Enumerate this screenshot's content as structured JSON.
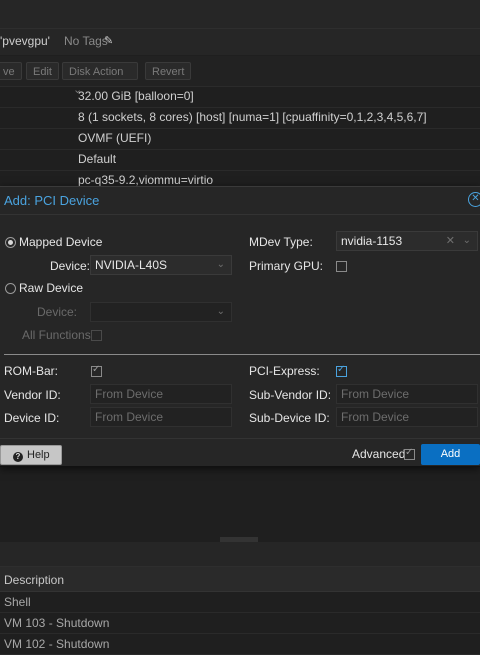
{
  "vm": {
    "name_fragment": "'pvevgpu'",
    "tags_label": "No Tags",
    "edit_tags_icon": "pencil-icon"
  },
  "toolbar": {
    "buttons": [
      "ve",
      "Edit",
      "Disk Action",
      "Revert"
    ],
    "disk_action_arrow": "⌵"
  },
  "hardware_rows": [
    "32.00 GiB [balloon=0]",
    "8 (1 sockets, 8 cores) [host] [numa=1] [cpuaffinity=0,1,2,3,4,5,6,7]",
    "OVMF (UEFI)",
    "Default",
    "pc-q35-9.2,viommu=virtio"
  ],
  "dialog": {
    "title": "Add: PCI Device",
    "close_icon": "close-circle-icon",
    "mapped_device_label": "Mapped Device",
    "mapped_device_selected": true,
    "device_label": "Device:",
    "device_value": "NVIDIA-L40S",
    "raw_device_label": "Raw Device",
    "raw_device_selected": false,
    "raw_device_field_label": "Device:",
    "all_functions_label": "All Functions:",
    "mdev_type_label": "MDev Type:",
    "mdev_type_value": "nvidia-1153",
    "primary_gpu_label": "Primary GPU:",
    "primary_gpu_checked": false,
    "rombar_label": "ROM-Bar:",
    "rombar_checked": true,
    "pcie_label": "PCI-Express:",
    "pcie_checked": true,
    "vendor_id_label": "Vendor ID:",
    "vendor_id_placeholder": "From Device",
    "device_id_label": "Device ID:",
    "device_id_placeholder": "From Device",
    "sub_vendor_id_label": "Sub-Vendor ID:",
    "sub_vendor_id_placeholder": "From Device",
    "sub_device_id_label": "Sub-Device ID:",
    "sub_device_id_placeholder": "From Device",
    "help_label": "Help",
    "advanced_label": "Advanced",
    "advanced_checked": true,
    "add_label": "Add"
  },
  "tasks": {
    "column_header": "Description",
    "rows": [
      "Shell",
      "VM 103 - Shutdown",
      "VM 102 - Shutdown"
    ]
  },
  "colors": {
    "accent": "#4aa3df",
    "primary_button": "#0a6fc2",
    "background": "#1f1f1f"
  }
}
